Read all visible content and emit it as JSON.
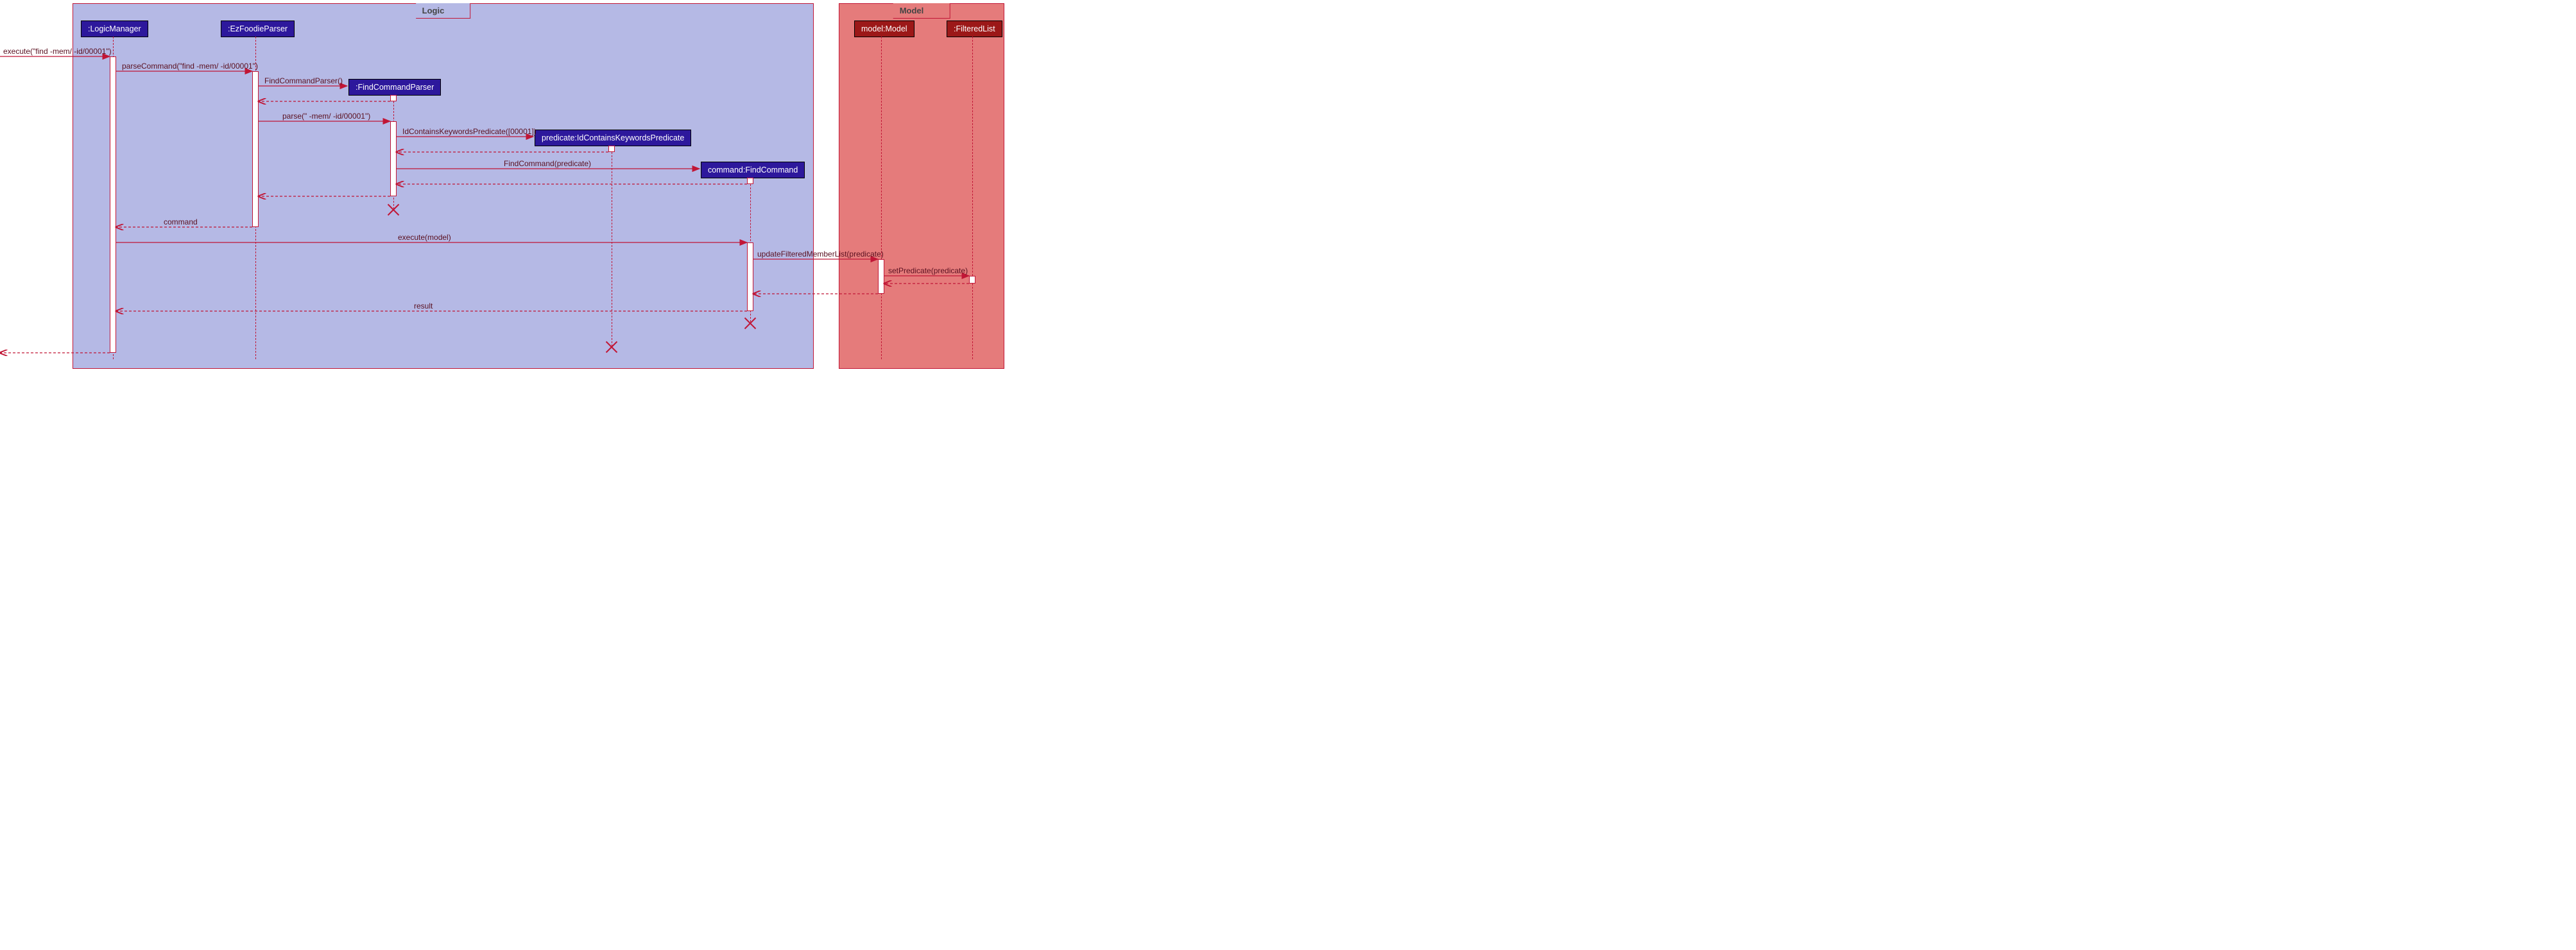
{
  "frames": {
    "logic": "Logic",
    "model": "Model"
  },
  "participants": {
    "logicManager": ":LogicManager",
    "ezFoodieParser": ":EzFoodieParser",
    "findCommandParser": ":FindCommandParser",
    "predicate": "predicate:IdContainsKeywordsPredicate",
    "findCommand": "command:FindCommand",
    "model": "model:Model",
    "filteredList": ":FilteredList"
  },
  "messages": {
    "m1": "execute(\"find -mem/ -id/00001\")",
    "m2": "parseCommand(\"find -mem/ -id/00001\")",
    "m3": "FindCommandParser()",
    "m4": "parse(\" -mem/ -id/00001\")",
    "m5": "IdContainsKeywordsPredicate([00001])",
    "m6": "FindCommand(predicate)",
    "m7": "command",
    "m8": "execute(model)",
    "m9": "updateFilteredMemberList(predicate)",
    "m10": "setPredicate(predicate)",
    "m11": "result"
  },
  "chart_data": {
    "type": "sequence-diagram",
    "frames": [
      {
        "name": "Logic",
        "participants": [
          "LogicManager",
          "EzFoodieParser",
          "FindCommandParser",
          "predicate:IdContainsKeywordsPredicate",
          "command:FindCommand"
        ]
      },
      {
        "name": "Model",
        "participants": [
          "model:Model",
          "FilteredList"
        ]
      }
    ],
    "participants": [
      {
        "id": "LogicManager",
        "label": ":LogicManager"
      },
      {
        "id": "EzFoodieParser",
        "label": ":EzFoodieParser"
      },
      {
        "id": "FindCommandParser",
        "label": ":FindCommandParser",
        "created_by_msg": 3,
        "destroyed": true
      },
      {
        "id": "Predicate",
        "label": "predicate:IdContainsKeywordsPredicate",
        "created_by_msg": 5,
        "destroyed": true
      },
      {
        "id": "FindCommand",
        "label": "command:FindCommand",
        "created_by_msg": 6,
        "destroyed": true
      },
      {
        "id": "Model",
        "label": "model:Model"
      },
      {
        "id": "FilteredList",
        "label": ":FilteredList"
      }
    ],
    "messages": [
      {
        "n": 1,
        "from": "caller",
        "to": "LogicManager",
        "type": "call",
        "label": "execute(\"find -mem/ -id/00001\")"
      },
      {
        "n": 2,
        "from": "LogicManager",
        "to": "EzFoodieParser",
        "type": "call",
        "label": "parseCommand(\"find -mem/ -id/00001\")"
      },
      {
        "n": 3,
        "from": "EzFoodieParser",
        "to": "FindCommandParser",
        "type": "create",
        "label": "FindCommandParser()"
      },
      {
        "n": 4,
        "from": "FindCommandParser",
        "to": "EzFoodieParser",
        "type": "return",
        "label": ""
      },
      {
        "n": 5,
        "from": "EzFoodieParser",
        "to": "FindCommandParser",
        "type": "call",
        "label": "parse(\" -mem/ -id/00001\")"
      },
      {
        "n": 6,
        "from": "FindCommandParser",
        "to": "Predicate",
        "type": "create",
        "label": "IdContainsKeywordsPredicate([00001])"
      },
      {
        "n": 7,
        "from": "Predicate",
        "to": "FindCommandParser",
        "type": "return",
        "label": ""
      },
      {
        "n": 8,
        "from": "FindCommandParser",
        "to": "FindCommand",
        "type": "create",
        "label": "FindCommand(predicate)"
      },
      {
        "n": 9,
        "from": "FindCommand",
        "to": "FindCommandParser",
        "type": "return",
        "label": ""
      },
      {
        "n": 10,
        "from": "FindCommandParser",
        "to": "EzFoodieParser",
        "type": "return",
        "label": ""
      },
      {
        "n": 11,
        "from": "EzFoodieParser",
        "to": "LogicManager",
        "type": "return",
        "label": "command"
      },
      {
        "n": 12,
        "from": "LogicManager",
        "to": "FindCommand",
        "type": "call",
        "label": "execute(model)"
      },
      {
        "n": 13,
        "from": "FindCommand",
        "to": "Model",
        "type": "call",
        "label": "updateFilteredMemberList(predicate)"
      },
      {
        "n": 14,
        "from": "Model",
        "to": "FilteredList",
        "type": "call",
        "label": "setPredicate(predicate)"
      },
      {
        "n": 15,
        "from": "FilteredList",
        "to": "Model",
        "type": "return",
        "label": ""
      },
      {
        "n": 16,
        "from": "Model",
        "to": "FindCommand",
        "type": "return",
        "label": ""
      },
      {
        "n": 17,
        "from": "FindCommand",
        "to": "LogicManager",
        "type": "return",
        "label": "result"
      },
      {
        "n": 18,
        "from": "LogicManager",
        "to": "caller",
        "type": "return",
        "label": ""
      }
    ]
  }
}
